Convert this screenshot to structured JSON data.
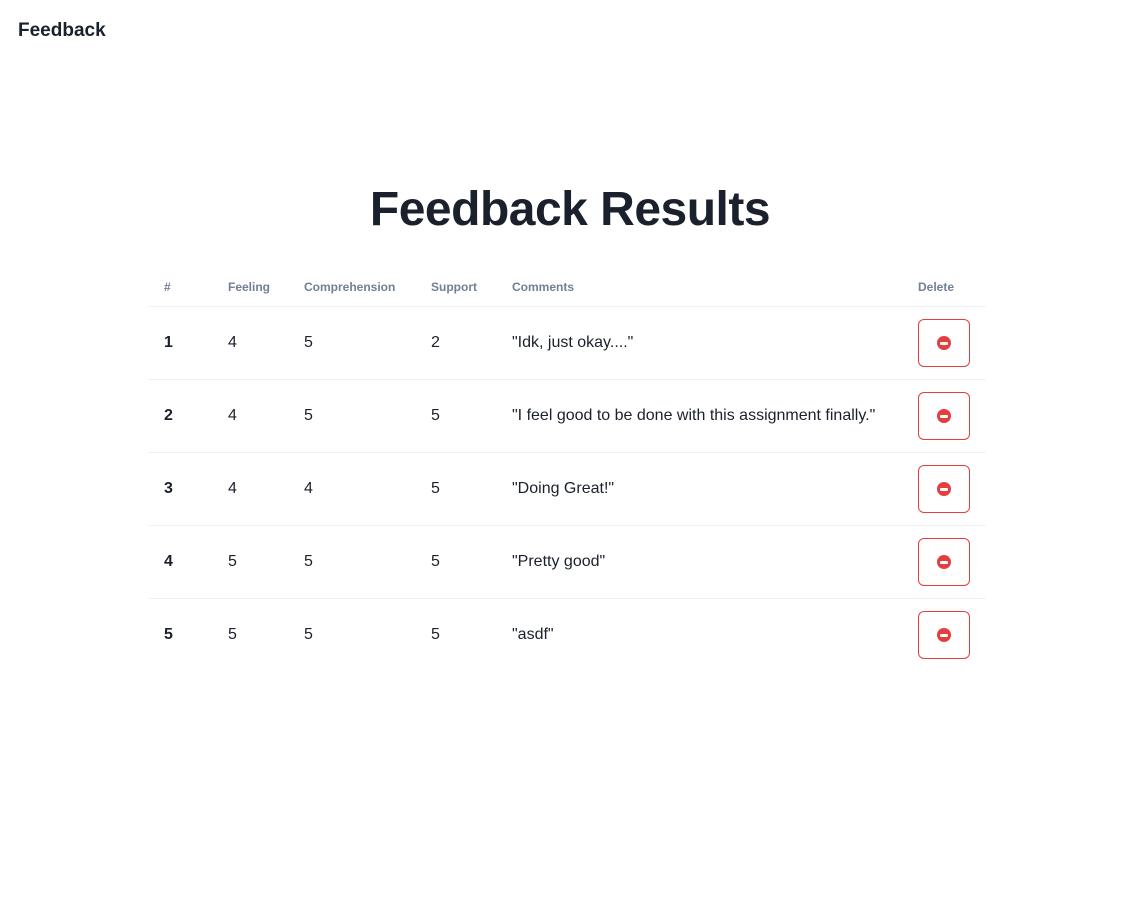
{
  "nav": {
    "brand": "Feedback"
  },
  "page": {
    "title": "Feedback Results"
  },
  "table": {
    "headers": [
      "#",
      "Feeling",
      "Comprehension",
      "Support",
      "Comments",
      "Delete"
    ],
    "rows": [
      {
        "id": "1",
        "feeling": "4",
        "comprehension": "5",
        "support": "2",
        "comments": "\"Idk, just okay....\""
      },
      {
        "id": "2",
        "feeling": "4",
        "comprehension": "5",
        "support": "5",
        "comments": "\"I feel good to be done with this assignment finally.\""
      },
      {
        "id": "3",
        "feeling": "4",
        "comprehension": "4",
        "support": "5",
        "comments": "\"Doing Great!\""
      },
      {
        "id": "4",
        "feeling": "5",
        "comprehension": "5",
        "support": "5",
        "comments": "\"Pretty good\""
      },
      {
        "id": "5",
        "feeling": "5",
        "comprehension": "5",
        "support": "5",
        "comments": "\"asdf\""
      }
    ]
  },
  "icons": {
    "delete": "no-entry-icon"
  },
  "colors": {
    "danger": "#e53e3e",
    "text": "#1a202c",
    "muted": "#718096"
  }
}
